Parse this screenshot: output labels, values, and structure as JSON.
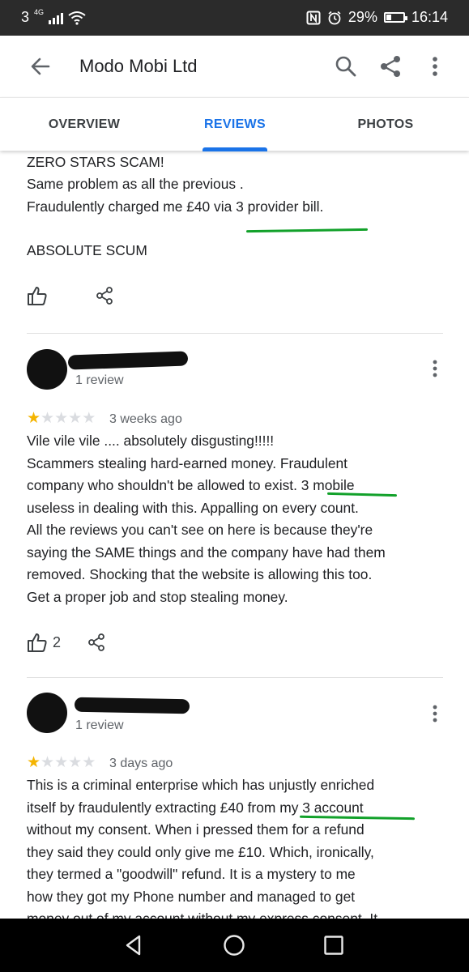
{
  "status_bar": {
    "network": "3",
    "network_type": "4G",
    "battery": "29%",
    "time": "16:14"
  },
  "app_bar": {
    "title": "Modo Mobi Ltd"
  },
  "tabs": [
    {
      "label": "OVERVIEW",
      "active": false
    },
    {
      "label": "REVIEWS",
      "active": true
    },
    {
      "label": "PHOTOS",
      "active": false
    }
  ],
  "reviews": [
    {
      "text_lines": [
        "ZERO STARS SCAM!",
        "Same problem as all the previous .",
        "Fraudulently charged me £40 via 3 provider bill.",
        "",
        "ABSOLUTE SCUM"
      ],
      "likes": ""
    },
    {
      "review_count": "1 review",
      "rating": 1,
      "time": "3 weeks ago",
      "text_lines": [
        "Vile vile vile .... absolutely disgusting!!!!!",
        "Scammers stealing hard-earned money. Fraudulent",
        "company who shouldn't be allowed to exist. 3 mobile",
        "useless in dealing with this. Appalling on every count.",
        "All the reviews you can't see on here is because they're",
        "saying the SAME things and the company have had them",
        "removed. Shocking that the website is allowing this too.",
        "Get a proper job and stop stealing money."
      ],
      "likes": "2"
    },
    {
      "review_count": "1 review",
      "rating": 1,
      "time": "3 days ago",
      "text_lines": [
        "This is a criminal enterprise which has unjustly enriched",
        "itself by fraudulently extracting £40 from my 3 account",
        "without my consent. When i pressed them for a refund",
        "they said they could only give me £10. Which, ironically,",
        "they termed a \"goodwill\" refund. It is a mystery to me",
        "how they got my Phone number and managed to get",
        "money out of my account without my express consent. It"
      ]
    }
  ],
  "colors": {
    "accent": "#1a73e8",
    "star": "#f4b400",
    "annotation": "#12a12a"
  }
}
